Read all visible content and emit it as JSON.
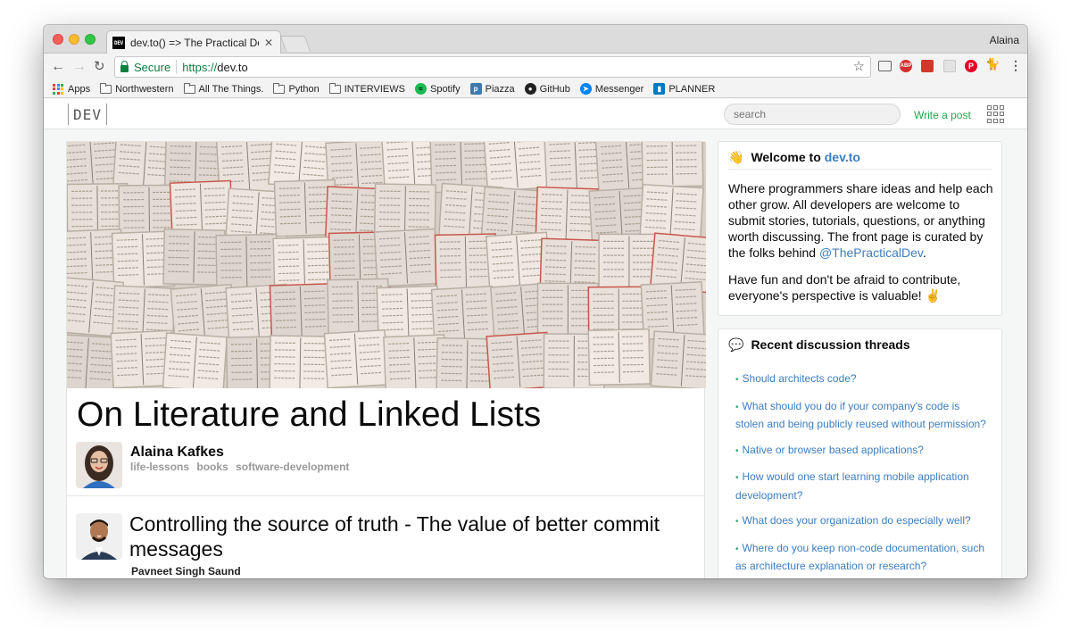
{
  "browser": {
    "tab_title": "dev.to() => The Practical Dev",
    "tab_close": "✕",
    "favicon_text": "DEV",
    "profile": "Alaina",
    "secure_label": "Secure",
    "url_scheme": "https://",
    "url_host": "dev.to",
    "abp_label": "ABP",
    "pin_label": "P"
  },
  "bookmarks": [
    {
      "label": "Apps",
      "icon": "apps-grid-icon"
    },
    {
      "label": "Northwestern",
      "icon": "folder-icon"
    },
    {
      "label": "All The Things.",
      "icon": "folder-icon"
    },
    {
      "label": "Python",
      "icon": "folder-icon"
    },
    {
      "label": "INTERVIEWS",
      "icon": "folder-icon"
    },
    {
      "label": "Spotify",
      "icon": "spotify-icon"
    },
    {
      "label": "Piazza",
      "icon": "piazza-icon"
    },
    {
      "label": "GitHub",
      "icon": "github-icon"
    },
    {
      "label": "Messenger",
      "icon": "messenger-icon"
    },
    {
      "label": "PLANNER",
      "icon": "trello-icon"
    }
  ],
  "devnav": {
    "logo": "DEV",
    "search_placeholder": "search",
    "write_post": "Write a post"
  },
  "featured": {
    "title": "On Literature and Linked Lists",
    "author": "Alaina Kafkes",
    "tags": [
      "life-lessons",
      "books",
      "software-development"
    ]
  },
  "second_post": {
    "title": "Controlling the source of truth - The value of better commit messages",
    "author": "Pavneet Singh Saund"
  },
  "welcome": {
    "emoji": "👋",
    "heading_prefix": "Welcome to",
    "heading_link": "dev.to",
    "para1_text": "Where programmers share ideas and help each other grow. All developers are welcome to submit stories, tutorials, questions, or anything worth discussing. The front page is curated by the folks behind",
    "para1_link": "@ThePracticalDev",
    "para1_end": ".",
    "para2": "Have fun and don't be afraid to contribute, everyone's perspective is valuable! ✌️"
  },
  "threads": {
    "emoji": "💬",
    "heading": "Recent discussion threads",
    "items": [
      "Should architects code?",
      "What should you do if your company's code is stolen and being publicly reused without permission?",
      "Native or browser based applications?",
      "How would one start learning mobile application development?",
      "What does your organization do especially well?",
      "Where do you keep non-code documentation, such as architecture explanation or research?"
    ]
  },
  "colors": {
    "accent_green": "#1fa84f",
    "link_blue": "#3b7ec2",
    "secure_green": "#0b8043"
  }
}
